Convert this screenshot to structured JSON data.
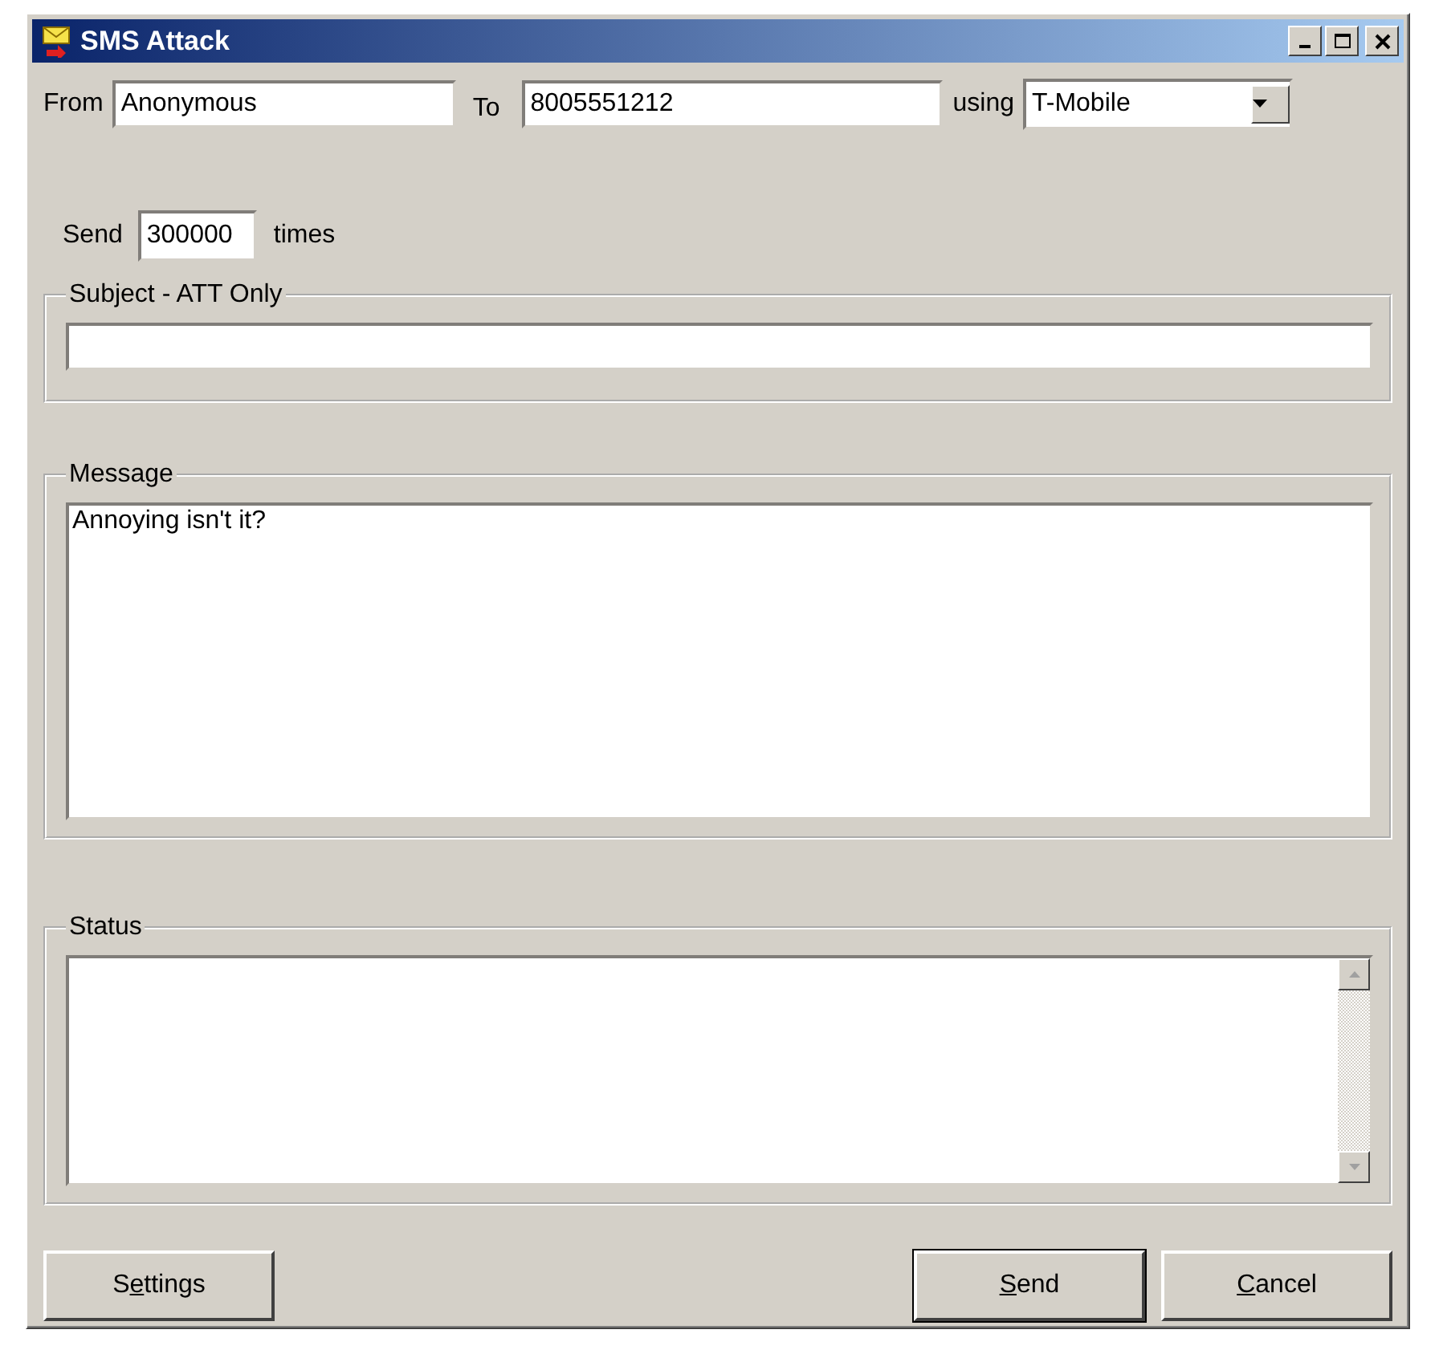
{
  "window": {
    "title": "SMS Attack"
  },
  "from": {
    "label": "From",
    "value": "Anonymous"
  },
  "to": {
    "label": "To",
    "value": "8005551212"
  },
  "carrier": {
    "label": "using",
    "value": "T-Mobile"
  },
  "repeat": {
    "label": "Send",
    "value": "300000",
    "suffix": "times"
  },
  "groups": [
    {
      "title": "Subject - ATT Only",
      "kind": "line"
    },
    {
      "title": "Message",
      "kind": "memo",
      "value": "Annoying isn't it?"
    },
    {
      "title": "Status",
      "kind": "log"
    }
  ],
  "buttons": [
    {
      "label": [
        {
          "text": "S",
          "underlined": false
        },
        {
          "text": "e",
          "underlined": true
        },
        {
          "text": "ttings",
          "underlined": false
        }
      ],
      "default": false
    },
    {
      "label": [
        {
          "text": "S",
          "underlined": true
        },
        {
          "text": "end",
          "underlined": false
        }
      ],
      "default": true
    },
    {
      "label": [
        {
          "text": "C",
          "underlined": true
        },
        {
          "text": "ancel",
          "underlined": false
        }
      ],
      "default": false
    }
  ]
}
